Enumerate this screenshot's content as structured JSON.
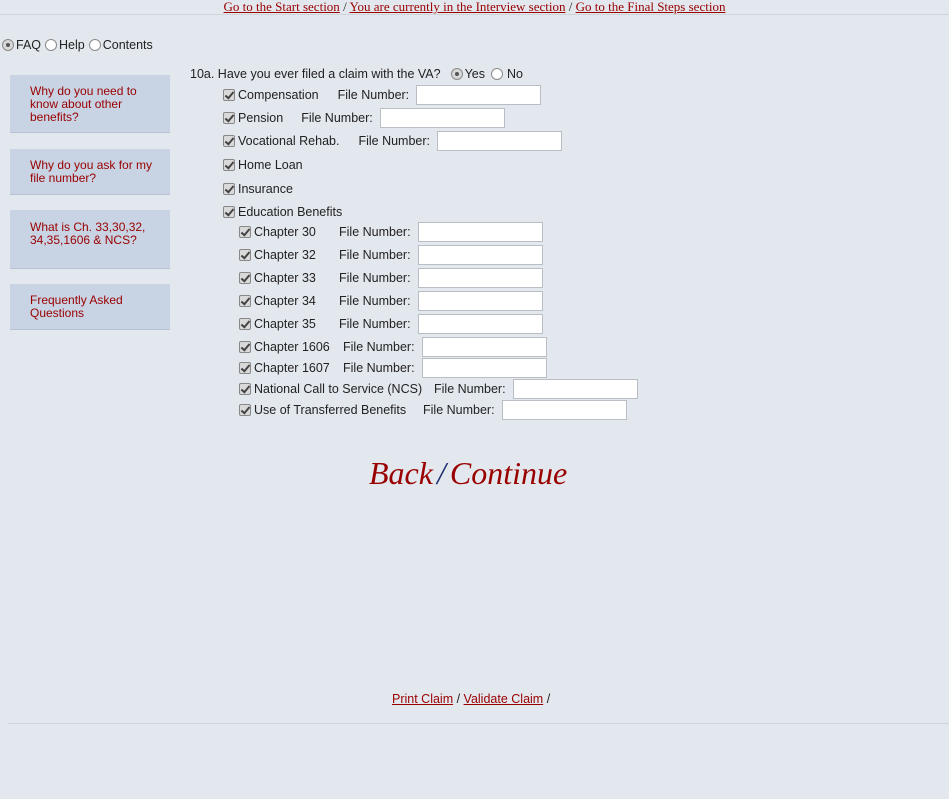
{
  "topnav": {
    "start": "Go to the Start section",
    "current": "You are currently in the Interview section",
    "final": "Go to the Final Steps section",
    "sep": " / "
  },
  "panel_tabs": [
    {
      "label": "FAQ",
      "selected": true
    },
    {
      "label": "Help",
      "selected": false
    },
    {
      "label": "Contents",
      "selected": false
    }
  ],
  "sidebar": [
    {
      "text": "Why do you need to know about other benefits?"
    },
    {
      "text": "Why do you ask for my file number?"
    },
    {
      "text": "What is Ch. 33,30,32,34,35,1606 & NCS?"
    },
    {
      "text": "Frequently Asked Questions"
    }
  ],
  "question": {
    "text": "10a. Have you ever filed a claim with the VA?",
    "yes": "Yes",
    "no": "No",
    "answer": "Yes"
  },
  "file_number_label": "File Number:",
  "benefits": [
    {
      "label": "Compensation",
      "checked": true,
      "file_number": "",
      "has_field": true
    },
    {
      "label": "Pension",
      "checked": true,
      "file_number": "",
      "has_field": true
    },
    {
      "label": "Vocational Rehab.",
      "checked": true,
      "file_number": "",
      "has_field": true
    },
    {
      "label": "Home Loan",
      "checked": true,
      "has_field": false
    },
    {
      "label": "Insurance",
      "checked": true,
      "has_field": false
    },
    {
      "label": "Education Benefits",
      "checked": true,
      "has_field": false
    }
  ],
  "education": [
    {
      "label": "Chapter 30",
      "checked": true,
      "file_number": ""
    },
    {
      "label": "Chapter 32",
      "checked": true,
      "file_number": ""
    },
    {
      "label": "Chapter 33",
      "checked": true,
      "file_number": ""
    },
    {
      "label": "Chapter 34",
      "checked": true,
      "file_number": ""
    },
    {
      "label": "Chapter 35",
      "checked": true,
      "file_number": ""
    },
    {
      "label": "Chapter 1606",
      "checked": true,
      "file_number": ""
    },
    {
      "label": "Chapter 1607",
      "checked": true,
      "file_number": ""
    },
    {
      "label": "National Call to Service (NCS)",
      "checked": true,
      "file_number": ""
    },
    {
      "label": "Use of Transferred Benefits",
      "checked": true,
      "file_number": ""
    }
  ],
  "nav": {
    "back": "Back",
    "slash": "/",
    "continue": "Continue"
  },
  "footer": {
    "print": "Print Claim",
    "validate": "Validate Claim",
    "sep": " / ",
    "trail": " /"
  }
}
